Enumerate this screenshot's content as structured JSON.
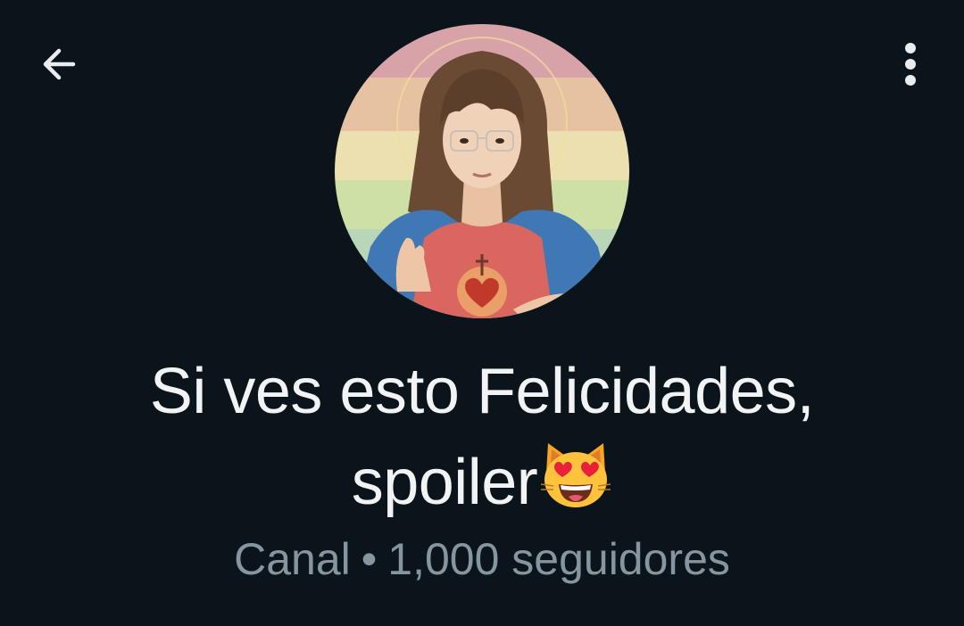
{
  "header": {
    "back_icon": "arrow-left-icon",
    "menu_icon": "more-vertical-icon",
    "icon_color": "#e9edef"
  },
  "channel": {
    "name": "Si ves esto Felicidades, spoiler",
    "name_emoji": "😻",
    "emoji_icon": "smiling-cat-heart-eyes-icon",
    "type_label": "Canal",
    "separator": "•",
    "followers": "1,000 seguidores",
    "avatar_icon": "channel-avatar-photo"
  },
  "colors": {
    "background": "#0b141a",
    "title_text": "#f1f3f4",
    "secondary_text": "#8696a0"
  }
}
